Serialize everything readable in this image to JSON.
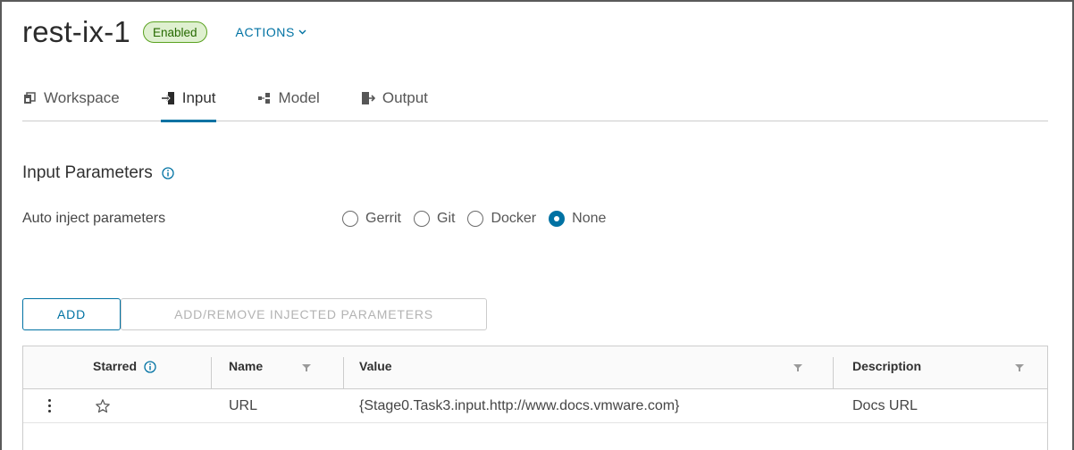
{
  "header": {
    "title": "rest-ix-1",
    "status": "Enabled",
    "actions_label": "ACTIONS"
  },
  "tabs": [
    {
      "label": "Workspace",
      "icon": "workspace-icon",
      "active": false
    },
    {
      "label": "Input",
      "icon": "input-icon",
      "active": true
    },
    {
      "label": "Model",
      "icon": "model-icon",
      "active": false
    },
    {
      "label": "Output",
      "icon": "output-icon",
      "active": false
    }
  ],
  "input_section": {
    "title": "Input Parameters",
    "auto_inject_label": "Auto inject parameters",
    "options": [
      {
        "label": "Gerrit",
        "checked": false
      },
      {
        "label": "Git",
        "checked": false
      },
      {
        "label": "Docker",
        "checked": false
      },
      {
        "label": "None",
        "checked": true
      }
    ]
  },
  "buttons": {
    "add": "ADD",
    "add_remove_injected": "ADD/REMOVE INJECTED PARAMETERS"
  },
  "grid": {
    "columns": {
      "starred": "Starred",
      "name": "Name",
      "value": "Value",
      "description": "Description"
    },
    "rows": [
      {
        "starred": false,
        "name": "URL",
        "value": "{Stage0.Task3.input.http://www.docs.vmware.com}",
        "description": "Docs URL"
      }
    ]
  },
  "colors": {
    "accent": "#0072a3",
    "status_bg": "#dff0d0",
    "status_border": "#5aa220",
    "status_text": "#266900"
  }
}
